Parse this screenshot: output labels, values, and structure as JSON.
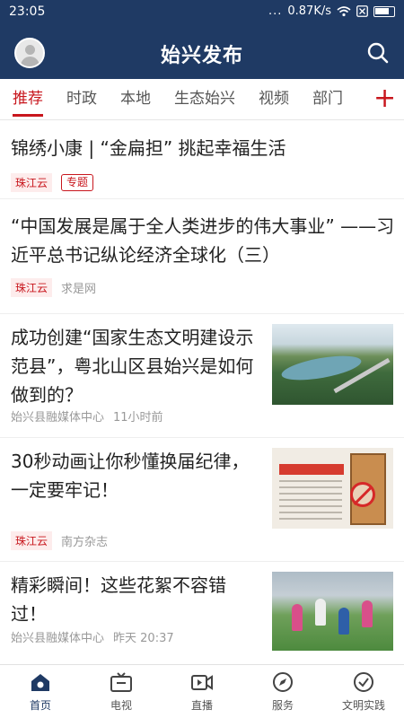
{
  "status_bar": {
    "time": "23:05",
    "dots": "...",
    "network_speed": "0.87K/s"
  },
  "header": {
    "title": "始兴发布",
    "avatar_icon": "avatar-icon",
    "search_icon": "search-icon",
    "bar_color": "#1f3a64"
  },
  "tabs": {
    "items": [
      {
        "label": "推荐",
        "active": true
      },
      {
        "label": "时政"
      },
      {
        "label": "本地"
      },
      {
        "label": "生态始兴"
      },
      {
        "label": "视频"
      },
      {
        "label": "部门"
      }
    ],
    "add_symbol": "+",
    "accent_color": "#c8161d"
  },
  "feed": {
    "items": [
      {
        "title": "锦绣小康 | “金扁担” 挑起幸福生活",
        "source": "珠江云",
        "topic_tag": "专题"
      },
      {
        "title": "“中国发展是属于全人类进步的伟大事业” ——习近平总书记纵论经济全球化（三）",
        "source": "珠江云",
        "publisher": "求是网"
      },
      {
        "title": "成功创建“国家生态文明建设示范县”，粤北山区县始兴是如何做到的？",
        "source": "始兴县融媒体中心",
        "time": "11小时前",
        "thumbnail": "landscape-aerial-image"
      },
      {
        "title": "30秒动画让你秒懂换届纪律，一定要牢记！",
        "source": "珠江云",
        "publisher": "南方杂志",
        "thumbnail": "discipline-cartoon-image"
      },
      {
        "title": "精彩瞬间！这些花絮不容错过！",
        "source": "始兴县融媒体中心",
        "time": "昨天 20:37",
        "thumbnail": "soccer-game-image"
      }
    ]
  },
  "bottom_nav": {
    "items": [
      {
        "label": "首页",
        "icon": "home-icon",
        "active": true
      },
      {
        "label": "电视",
        "icon": "tv-icon"
      },
      {
        "label": "直播",
        "icon": "live-video-icon"
      },
      {
        "label": "服务",
        "icon": "compass-icon"
      },
      {
        "label": "文明实践",
        "icon": "civilization-practice-icon"
      }
    ]
  }
}
